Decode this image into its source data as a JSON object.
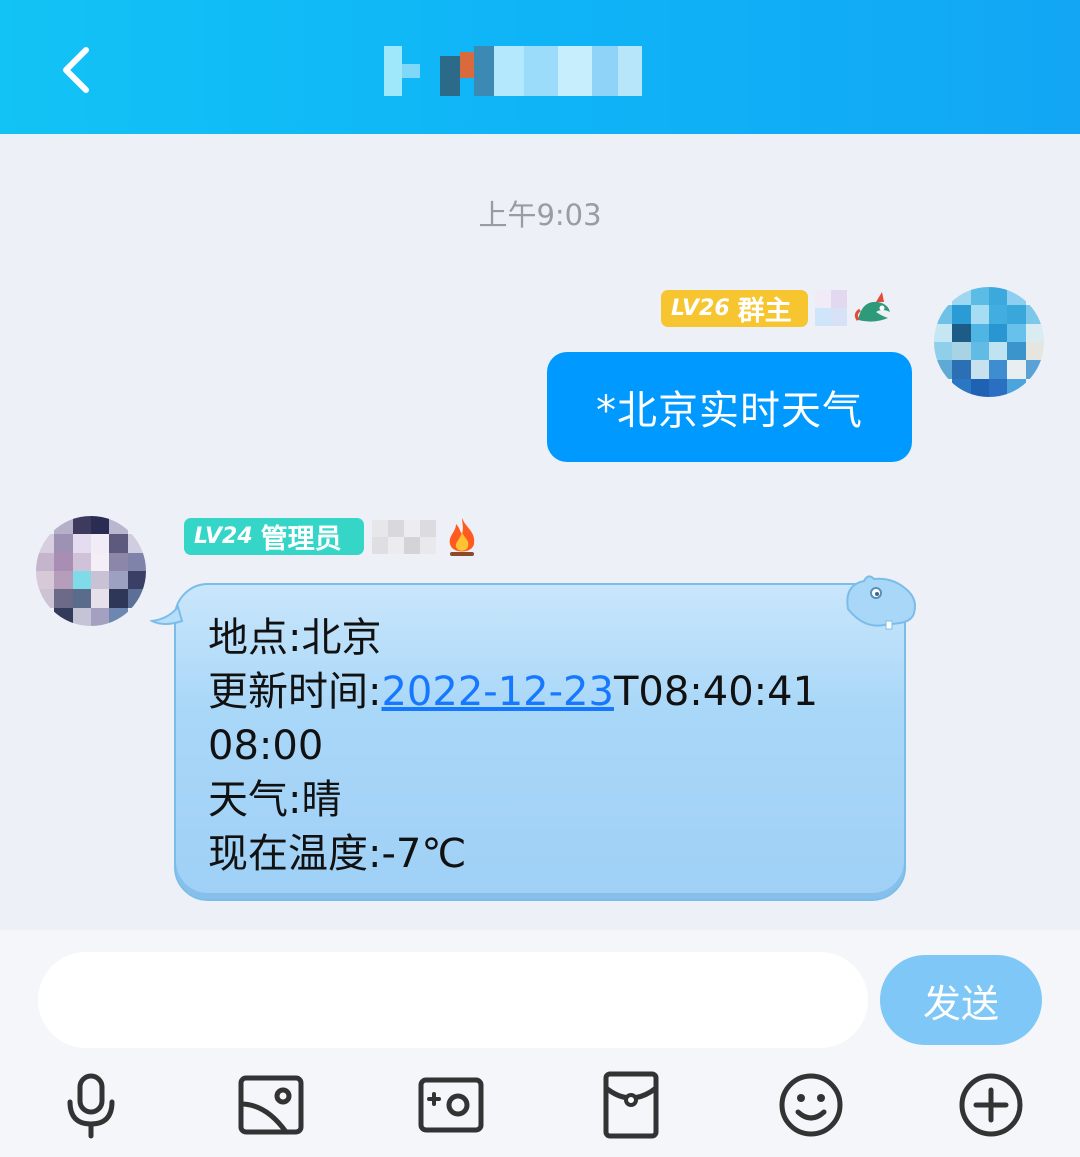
{
  "header": {
    "back_icon": "chevron-left-icon",
    "title_hidden": "pixelated-group-name"
  },
  "chat": {
    "timestamp": "上午9:03",
    "messages": [
      {
        "direction": "outgoing",
        "level": "LV26",
        "role": "群主",
        "role_color": "#f7c530",
        "text": "*北京实时天气"
      },
      {
        "direction": "incoming",
        "level": "LV24",
        "role": "管理员",
        "role_color": "#35d6c8",
        "lines": {
          "l1": "地点:北京",
          "l2_prefix": "更新时间:",
          "l2_link": "2022-12-23",
          "l2_suffix": "T08:40:41",
          "l3": "08:00",
          "l4": "天气:晴",
          "l5": "现在温度:-7℃"
        }
      }
    ]
  },
  "composer": {
    "input_value": "",
    "input_placeholder": "",
    "send_label": "发送"
  },
  "toolbar": [
    "microphone-icon",
    "gallery-icon",
    "camera-icon",
    "red-packet-icon",
    "emoji-icon",
    "plus-icon"
  ],
  "colors": {
    "header": "#12b6f6",
    "outgoing_bubble": "#0099ff",
    "send_button": "#7ec7f6",
    "link": "#1677ff"
  }
}
